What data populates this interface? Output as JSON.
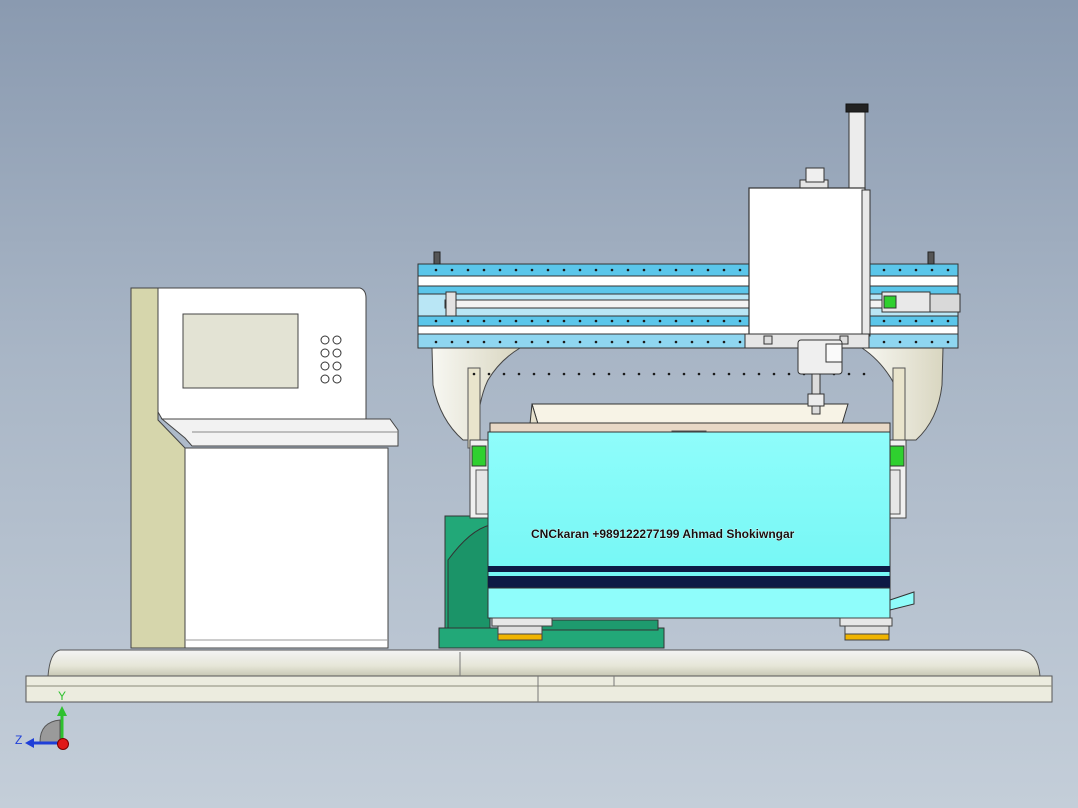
{
  "viewport": {
    "label_text": "CNCkaran  +989122277199    Ahmad Shokiwngar"
  },
  "triad": {
    "y_label": "Y",
    "z_label": "Z",
    "colors": {
      "y": "#2fc12f",
      "z": "#1f3fd8",
      "x": "#e01818"
    }
  },
  "colors": {
    "body_cyan": "#7ffbf9",
    "rail_blue": "#5bc6ea",
    "base_green": "#22a878",
    "stripe_navy": "#0d1a45",
    "cabinet_side": "#d6d6ac"
  }
}
